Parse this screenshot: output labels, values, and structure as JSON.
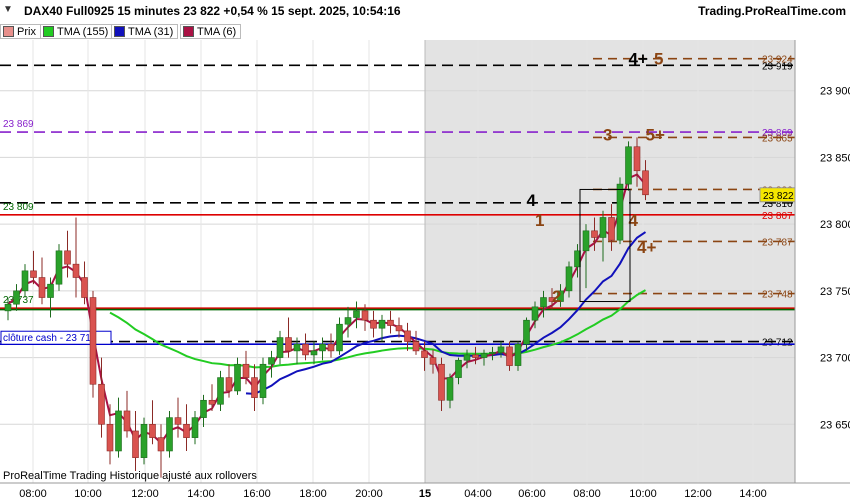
{
  "header": {
    "title": "DAX40 Full0925 15 minutes 23 822 +0,54 % 15 sept. 2025, 10:54:16",
    "brand": "Trading.ProRealTime.com"
  },
  "legend": [
    {
      "label": "Prix",
      "color": "#d9534f"
    },
    {
      "label": "TMA (155)",
      "color": "#22cc22"
    },
    {
      "label": "TMA (31)",
      "color": "#1111bb"
    },
    {
      "label": "TMA (6)",
      "color": "#aa1144"
    }
  ],
  "footer": "ProRealTime Trading  Historique ajusté aux rollovers",
  "chart_data": {
    "type": "candlestick",
    "x_ticks": [
      "08:00",
      "10:00",
      "12:00",
      "14:00",
      "16:00",
      "18:00",
      "20:00",
      "15",
      "04:00",
      "06:00",
      "08:00",
      "10:00",
      "12:00",
      "14:00"
    ],
    "y_ticks": [
      23650,
      23700,
      23750,
      23800,
      23850,
      23900
    ],
    "ylim": [
      23606,
      23938
    ],
    "last_price": "23 822",
    "candles": [
      [
        23735,
        23745,
        23728,
        23740
      ],
      [
        23740,
        23755,
        23735,
        23750
      ],
      [
        23750,
        23770,
        23745,
        23765
      ],
      [
        23765,
        23780,
        23755,
        23760
      ],
      [
        23760,
        23775,
        23740,
        23745
      ],
      [
        23745,
        23760,
        23730,
        23755
      ],
      [
        23755,
        23785,
        23750,
        23780
      ],
      [
        23780,
        23795,
        23760,
        23770
      ],
      [
        23770,
        23805,
        23745,
        23760
      ],
      [
        23760,
        23772,
        23740,
        23745
      ],
      [
        23745,
        23750,
        23670,
        23680
      ],
      [
        23680,
        23700,
        23640,
        23650
      ],
      [
        23650,
        23665,
        23620,
        23630
      ],
      [
        23630,
        23670,
        23625,
        23660
      ],
      [
        23660,
        23675,
        23640,
        23645
      ],
      [
        23645,
        23660,
        23615,
        23625
      ],
      [
        23625,
        23655,
        23620,
        23650
      ],
      [
        23650,
        23668,
        23635,
        23640
      ],
      [
        23640,
        23650,
        23610,
        23630
      ],
      [
        23630,
        23660,
        23625,
        23655
      ],
      [
        23655,
        23670,
        23640,
        23650
      ],
      [
        23650,
        23665,
        23630,
        23640
      ],
      [
        23640,
        23660,
        23635,
        23655
      ],
      [
        23655,
        23672,
        23648,
        23668
      ],
      [
        23668,
        23680,
        23660,
        23665
      ],
      [
        23665,
        23690,
        23660,
        23685
      ],
      [
        23685,
        23695,
        23670,
        23675
      ],
      [
        23675,
        23700,
        23672,
        23695
      ],
      [
        23695,
        23705,
        23680,
        23685
      ],
      [
        23685,
        23695,
        23660,
        23670
      ],
      [
        23670,
        23700,
        23665,
        23695
      ],
      [
        23695,
        23705,
        23685,
        23700
      ],
      [
        23700,
        23720,
        23695,
        23715
      ],
      [
        23715,
        23730,
        23700,
        23705
      ],
      [
        23705,
        23715,
        23695,
        23710
      ],
      [
        23710,
        23718,
        23698,
        23702
      ],
      [
        23702,
        23712,
        23695,
        23705
      ],
      [
        23705,
        23715,
        23698,
        23710
      ],
      [
        23710,
        23718,
        23700,
        23705
      ],
      [
        23705,
        23730,
        23702,
        23725
      ],
      [
        23725,
        23738,
        23715,
        23730
      ],
      [
        23730,
        23742,
        23722,
        23735
      ],
      [
        23735,
        23740,
        23720,
        23728
      ],
      [
        23728,
        23735,
        23715,
        23722
      ],
      [
        23722,
        23732,
        23712,
        23728
      ],
      [
        23728,
        23735,
        23718,
        23724
      ],
      [
        23724,
        23730,
        23715,
        23720
      ],
      [
        23720,
        23726,
        23705,
        23712
      ],
      [
        23712,
        23720,
        23702,
        23705
      ],
      [
        23705,
        23712,
        23690,
        23700
      ],
      [
        23700,
        23706,
        23688,
        23695
      ],
      [
        23695,
        23700,
        23660,
        23668
      ],
      [
        23668,
        23688,
        23662,
        23685
      ],
      [
        23685,
        23700,
        23680,
        23698
      ],
      [
        23698,
        23706,
        23692,
        23702
      ],
      [
        23702,
        23708,
        23695,
        23700
      ],
      [
        23700,
        23706,
        23694,
        23703
      ],
      [
        23703,
        23708,
        23698,
        23704
      ],
      [
        23704,
        23712,
        23700,
        23708
      ],
      [
        23708,
        23712,
        23690,
        23694
      ],
      [
        23694,
        23712,
        23690,
        23710
      ],
      [
        23710,
        23730,
        23705,
        23728
      ],
      [
        23728,
        23742,
        23722,
        23738
      ],
      [
        23738,
        23750,
        23730,
        23745
      ],
      [
        23745,
        23752,
        23736,
        23742
      ],
      [
        23742,
        23755,
        23738,
        23750
      ],
      [
        23750,
        23772,
        23745,
        23768
      ],
      [
        23768,
        23785,
        23760,
        23780
      ],
      [
        23780,
        23800,
        23752,
        23795
      ],
      [
        23795,
        23805,
        23780,
        23790
      ],
      [
        23790,
        23810,
        23772,
        23805
      ],
      [
        23805,
        23815,
        23780,
        23788
      ],
      [
        23788,
        23835,
        23785,
        23830
      ],
      [
        23830,
        23862,
        23825,
        23858
      ],
      [
        23858,
        23865,
        23828,
        23840
      ],
      [
        23840,
        23848,
        23818,
        23822
      ]
    ],
    "series": [
      {
        "name": "TMA (155)",
        "color": "#22cc22"
      },
      {
        "name": "TMA (31)",
        "color": "#1111bb"
      },
      {
        "name": "TMA (6)",
        "color": "#aa1144"
      }
    ],
    "horizontal_levels": [
      {
        "price": 23919,
        "style": "dash",
        "color": "#000000",
        "label": "23 919"
      },
      {
        "price": 23924,
        "style": "dash",
        "color": "#8b4513",
        "label": "23 924"
      },
      {
        "price": 23869,
        "style": "dash",
        "color": "#8822cc",
        "label": "23 869",
        "left_label": "23 869"
      },
      {
        "price": 23865,
        "style": "dash",
        "color": "#8b4513",
        "label": "23 865"
      },
      {
        "price": 23826,
        "style": "dash",
        "color": "#8b4513",
        "label": "23 826"
      },
      {
        "price": 23816,
        "style": "dash",
        "color": "#000000",
        "label": "23 816"
      },
      {
        "price": 23807,
        "style": "solid",
        "color": "#dd0000",
        "label": "23 807",
        "left_label": "23 809"
      },
      {
        "price": 23787,
        "style": "dash",
        "color": "#8b4513",
        "label": "23 787"
      },
      {
        "price": 23748,
        "style": "dash",
        "color": "#8b4513",
        "label": "23 748"
      },
      {
        "price": 23737,
        "style": "solid",
        "color": "#dd0000",
        "label": "",
        "left_label": "23 737"
      },
      {
        "price": 23736,
        "style": "solid",
        "color": "#006600",
        "label": ""
      },
      {
        "price": 23712,
        "style": "dash",
        "color": "#000000",
        "label": "23 712"
      },
      {
        "price": 23710,
        "style": "solid",
        "color": "#0000cc",
        "label": "",
        "left_label": "clôture cash -  23 710"
      }
    ],
    "annotations": [
      {
        "text": "4+",
        "color": "#000000",
        "price": 23924,
        "x_index": 73
      },
      {
        "text": "5",
        "color": "#8b4513",
        "price": 23924,
        "x_index": 76
      },
      {
        "text": "3",
        "color": "#8b4513",
        "price": 23867,
        "x_index": 70
      },
      {
        "text": "5+",
        "color": "#8b4513",
        "price": 23867,
        "x_index": 75
      },
      {
        "text": "4",
        "color": "#000000",
        "price": 23818,
        "x_index": 61
      },
      {
        "text": "1",
        "color": "#8b4513",
        "price": 23803,
        "x_index": 62
      },
      {
        "text": "4",
        "color": "#8b4513",
        "price": 23803,
        "x_index": 73
      },
      {
        "text": "4+",
        "color": "#8b4513",
        "price": 23783,
        "x_index": 74
      },
      {
        "text": "2",
        "color": "#8b4513",
        "price": 23746,
        "x_index": 64
      }
    ]
  }
}
